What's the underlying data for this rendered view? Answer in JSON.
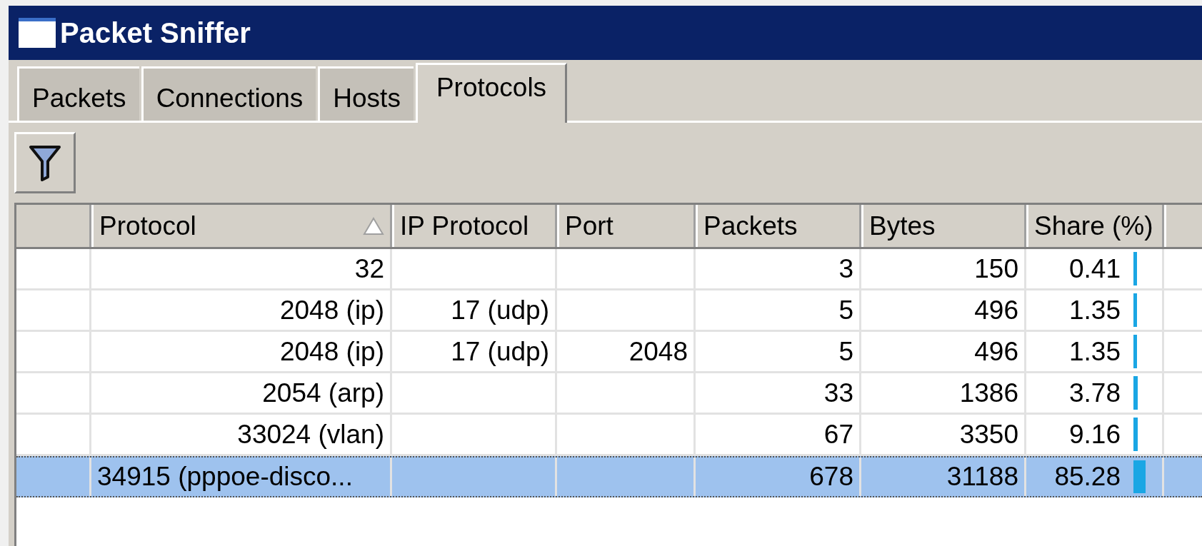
{
  "window": {
    "title": "Packet Sniffer"
  },
  "tabs": [
    {
      "label": "Packets",
      "selected": false
    },
    {
      "label": "Connections",
      "selected": false
    },
    {
      "label": "Hosts",
      "selected": false
    },
    {
      "label": "Protocols",
      "selected": true
    }
  ],
  "table": {
    "columns": [
      {
        "label": "Protocol",
        "sorted": true
      },
      {
        "label": "IP Protocol",
        "sorted": false
      },
      {
        "label": "Port",
        "sorted": false
      },
      {
        "label": "Packets",
        "sorted": false
      },
      {
        "label": "Bytes",
        "sorted": false
      },
      {
        "label": "Share (%)",
        "sorted": false
      }
    ],
    "rows": [
      {
        "protocol": "32",
        "packets": "3",
        "bytes": "150",
        "share": "0.41",
        "selected": false
      },
      {
        "protocol": "2048 (ip)",
        "ip_protocol": "17 (udp)",
        "packets": "5",
        "bytes": "496",
        "share": "1.35",
        "selected": false
      },
      {
        "protocol": "2048 (ip)",
        "ip_protocol": "17 (udp)",
        "port": "2048",
        "packets": "5",
        "bytes": "496",
        "share": "1.35",
        "selected": false
      },
      {
        "protocol": "2054 (arp)",
        "packets": "33",
        "bytes": "1386",
        "share": "3.78",
        "selected": false
      },
      {
        "protocol": "33024 (vlan)",
        "packets": "67",
        "bytes": "3350",
        "share": "9.16",
        "selected": false
      },
      {
        "protocol": "34915 (pppoe-disco...",
        "packets": "678",
        "bytes": "31188",
        "share": "85.28",
        "selected": true
      }
    ]
  }
}
